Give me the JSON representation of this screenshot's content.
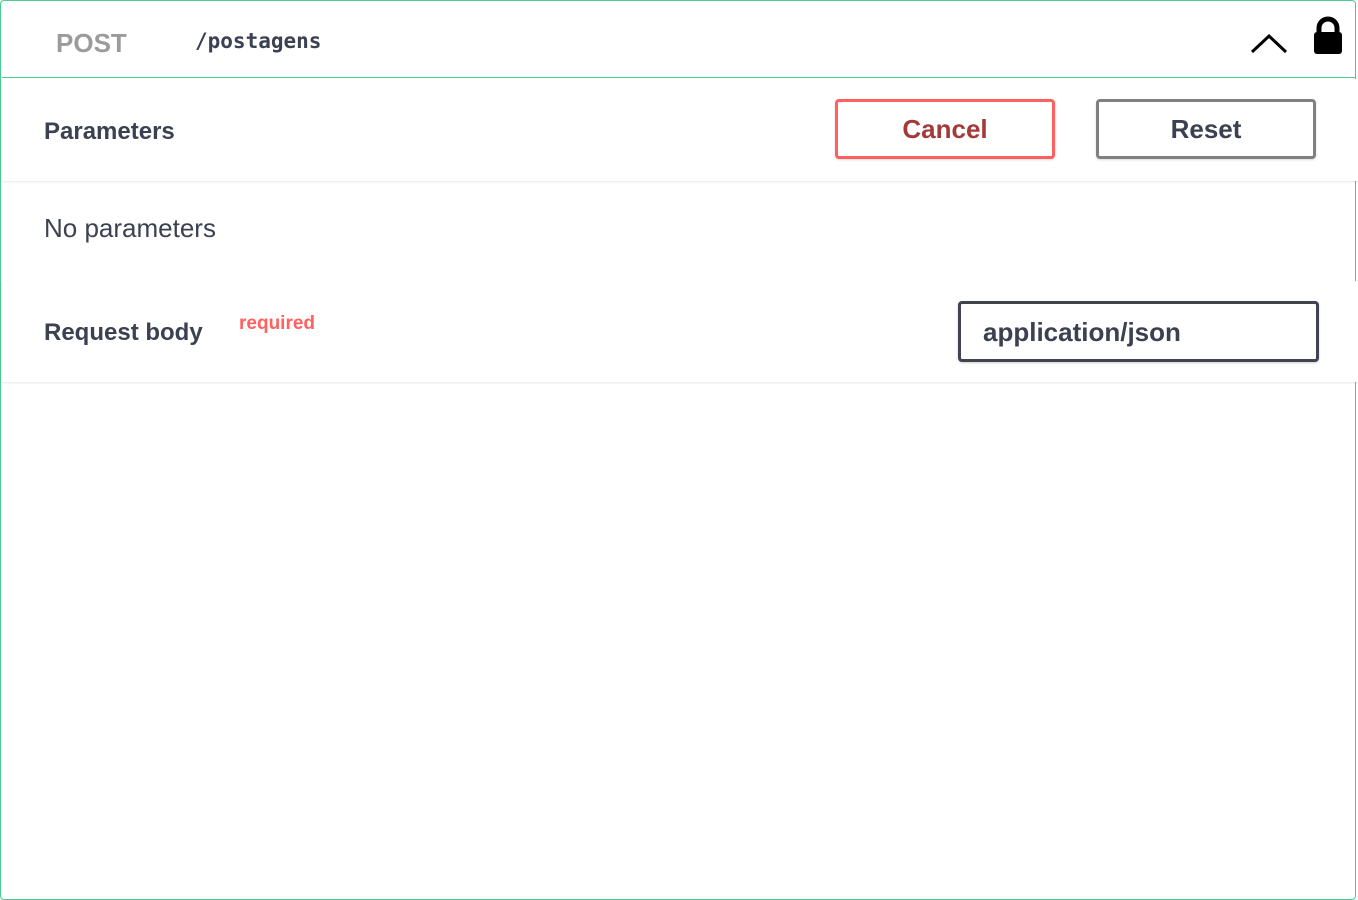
{
  "operation": {
    "method": "POST",
    "path": "/postagens",
    "collapse_icon": "chevron-up-icon",
    "auth_icon": "lock-icon"
  },
  "parameters": {
    "title": "Parameters",
    "cancel_label": "Cancel",
    "reset_label": "Reset",
    "empty_text": "No parameters"
  },
  "request_body": {
    "title": "Request body",
    "required_label": "required",
    "content_type": "application/json"
  },
  "colors": {
    "post_border": "#49cc90",
    "cancel": "#ff6060",
    "text": "#3b4151"
  }
}
